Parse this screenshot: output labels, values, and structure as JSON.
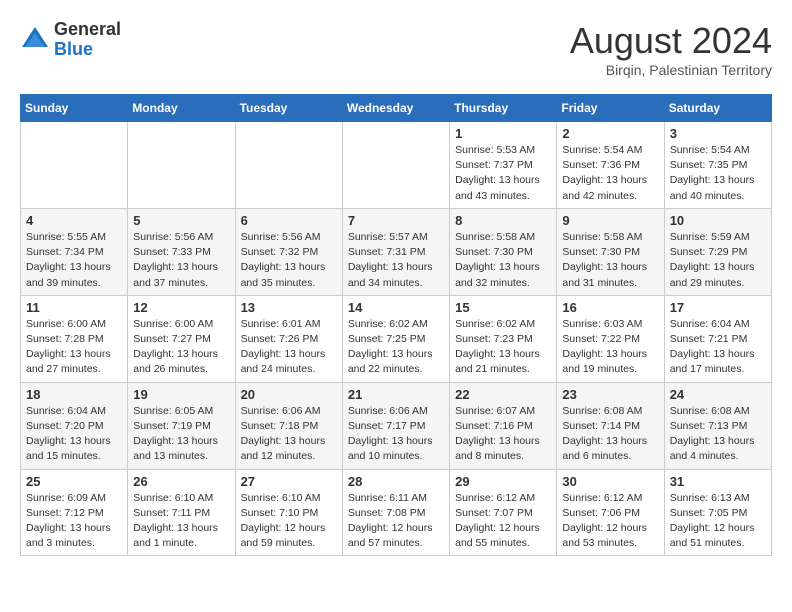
{
  "header": {
    "logo_line1": "General",
    "logo_line2": "Blue",
    "month": "August 2024",
    "location": "Birqin, Palestinian Territory"
  },
  "weekdays": [
    "Sunday",
    "Monday",
    "Tuesday",
    "Wednesday",
    "Thursday",
    "Friday",
    "Saturday"
  ],
  "weeks": [
    [
      {
        "day": "",
        "detail": ""
      },
      {
        "day": "",
        "detail": ""
      },
      {
        "day": "",
        "detail": ""
      },
      {
        "day": "",
        "detail": ""
      },
      {
        "day": "1",
        "detail": "Sunrise: 5:53 AM\nSunset: 7:37 PM\nDaylight: 13 hours\nand 43 minutes."
      },
      {
        "day": "2",
        "detail": "Sunrise: 5:54 AM\nSunset: 7:36 PM\nDaylight: 13 hours\nand 42 minutes."
      },
      {
        "day": "3",
        "detail": "Sunrise: 5:54 AM\nSunset: 7:35 PM\nDaylight: 13 hours\nand 40 minutes."
      }
    ],
    [
      {
        "day": "4",
        "detail": "Sunrise: 5:55 AM\nSunset: 7:34 PM\nDaylight: 13 hours\nand 39 minutes."
      },
      {
        "day": "5",
        "detail": "Sunrise: 5:56 AM\nSunset: 7:33 PM\nDaylight: 13 hours\nand 37 minutes."
      },
      {
        "day": "6",
        "detail": "Sunrise: 5:56 AM\nSunset: 7:32 PM\nDaylight: 13 hours\nand 35 minutes."
      },
      {
        "day": "7",
        "detail": "Sunrise: 5:57 AM\nSunset: 7:31 PM\nDaylight: 13 hours\nand 34 minutes."
      },
      {
        "day": "8",
        "detail": "Sunrise: 5:58 AM\nSunset: 7:30 PM\nDaylight: 13 hours\nand 32 minutes."
      },
      {
        "day": "9",
        "detail": "Sunrise: 5:58 AM\nSunset: 7:30 PM\nDaylight: 13 hours\nand 31 minutes."
      },
      {
        "day": "10",
        "detail": "Sunrise: 5:59 AM\nSunset: 7:29 PM\nDaylight: 13 hours\nand 29 minutes."
      }
    ],
    [
      {
        "day": "11",
        "detail": "Sunrise: 6:00 AM\nSunset: 7:28 PM\nDaylight: 13 hours\nand 27 minutes."
      },
      {
        "day": "12",
        "detail": "Sunrise: 6:00 AM\nSunset: 7:27 PM\nDaylight: 13 hours\nand 26 minutes."
      },
      {
        "day": "13",
        "detail": "Sunrise: 6:01 AM\nSunset: 7:26 PM\nDaylight: 13 hours\nand 24 minutes."
      },
      {
        "day": "14",
        "detail": "Sunrise: 6:02 AM\nSunset: 7:25 PM\nDaylight: 13 hours\nand 22 minutes."
      },
      {
        "day": "15",
        "detail": "Sunrise: 6:02 AM\nSunset: 7:23 PM\nDaylight: 13 hours\nand 21 minutes."
      },
      {
        "day": "16",
        "detail": "Sunrise: 6:03 AM\nSunset: 7:22 PM\nDaylight: 13 hours\nand 19 minutes."
      },
      {
        "day": "17",
        "detail": "Sunrise: 6:04 AM\nSunset: 7:21 PM\nDaylight: 13 hours\nand 17 minutes."
      }
    ],
    [
      {
        "day": "18",
        "detail": "Sunrise: 6:04 AM\nSunset: 7:20 PM\nDaylight: 13 hours\nand 15 minutes."
      },
      {
        "day": "19",
        "detail": "Sunrise: 6:05 AM\nSunset: 7:19 PM\nDaylight: 13 hours\nand 13 minutes."
      },
      {
        "day": "20",
        "detail": "Sunrise: 6:06 AM\nSunset: 7:18 PM\nDaylight: 13 hours\nand 12 minutes."
      },
      {
        "day": "21",
        "detail": "Sunrise: 6:06 AM\nSunset: 7:17 PM\nDaylight: 13 hours\nand 10 minutes."
      },
      {
        "day": "22",
        "detail": "Sunrise: 6:07 AM\nSunset: 7:16 PM\nDaylight: 13 hours\nand 8 minutes."
      },
      {
        "day": "23",
        "detail": "Sunrise: 6:08 AM\nSunset: 7:14 PM\nDaylight: 13 hours\nand 6 minutes."
      },
      {
        "day": "24",
        "detail": "Sunrise: 6:08 AM\nSunset: 7:13 PM\nDaylight: 13 hours\nand 4 minutes."
      }
    ],
    [
      {
        "day": "25",
        "detail": "Sunrise: 6:09 AM\nSunset: 7:12 PM\nDaylight: 13 hours\nand 3 minutes."
      },
      {
        "day": "26",
        "detail": "Sunrise: 6:10 AM\nSunset: 7:11 PM\nDaylight: 13 hours\nand 1 minute."
      },
      {
        "day": "27",
        "detail": "Sunrise: 6:10 AM\nSunset: 7:10 PM\nDaylight: 12 hours\nand 59 minutes."
      },
      {
        "day": "28",
        "detail": "Sunrise: 6:11 AM\nSunset: 7:08 PM\nDaylight: 12 hours\nand 57 minutes."
      },
      {
        "day": "29",
        "detail": "Sunrise: 6:12 AM\nSunset: 7:07 PM\nDaylight: 12 hours\nand 55 minutes."
      },
      {
        "day": "30",
        "detail": "Sunrise: 6:12 AM\nSunset: 7:06 PM\nDaylight: 12 hours\nand 53 minutes."
      },
      {
        "day": "31",
        "detail": "Sunrise: 6:13 AM\nSunset: 7:05 PM\nDaylight: 12 hours\nand 51 minutes."
      }
    ]
  ]
}
